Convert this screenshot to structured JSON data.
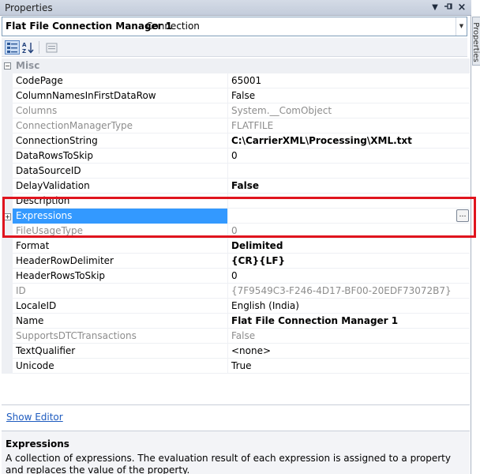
{
  "window": {
    "title": "Properties"
  },
  "object_selector": {
    "name": "Flat File Connection Manager 1",
    "type": "Connection"
  },
  "side_tab": {
    "label": "Properties"
  },
  "category": {
    "name": "Misc"
  },
  "rows": [
    {
      "name": "CodePage",
      "value": "65001"
    },
    {
      "name": "ColumnNamesInFirstDataRow",
      "value": "False"
    },
    {
      "name": "Columns",
      "value": "System.__ComObject"
    },
    {
      "name": "ConnectionManagerType",
      "value": "FLATFILE"
    },
    {
      "name": "ConnectionString",
      "value": "C:\\CarrierXML\\Processing\\XML.txt"
    },
    {
      "name": "DataRowsToSkip",
      "value": "0"
    },
    {
      "name": "DataSourceID",
      "value": ""
    },
    {
      "name": "DelayValidation",
      "value": "False"
    },
    {
      "name": "Description",
      "value": ""
    },
    {
      "name": "Expressions",
      "value": ""
    },
    {
      "name": "FileUsageType",
      "value": "0"
    },
    {
      "name": "Format",
      "value": "Delimited"
    },
    {
      "name": "HeaderRowDelimiter",
      "value": "{CR}{LF}"
    },
    {
      "name": "HeaderRowsToSkip",
      "value": "0"
    },
    {
      "name": "ID",
      "value": "{7F9549C3-F246-4D17-BF00-20EDF73072B7}"
    },
    {
      "name": "LocaleID",
      "value": "English (India)"
    },
    {
      "name": "Name",
      "value": "Flat File Connection Manager 1"
    },
    {
      "name": "SupportsDTCTransactions",
      "value": "False"
    },
    {
      "name": "TextQualifier",
      "value": "<none>"
    },
    {
      "name": "Unicode",
      "value": "True"
    }
  ],
  "commands": {
    "show_editor": "Show Editor"
  },
  "description": {
    "title": "Expressions",
    "text": "A collection of expressions. The evaluation result of each expression is assigned to a property and replaces the value of the property."
  },
  "colors": {
    "selection": "#3399ff",
    "highlight_box": "#e0141e",
    "link": "#1e5bbf"
  }
}
